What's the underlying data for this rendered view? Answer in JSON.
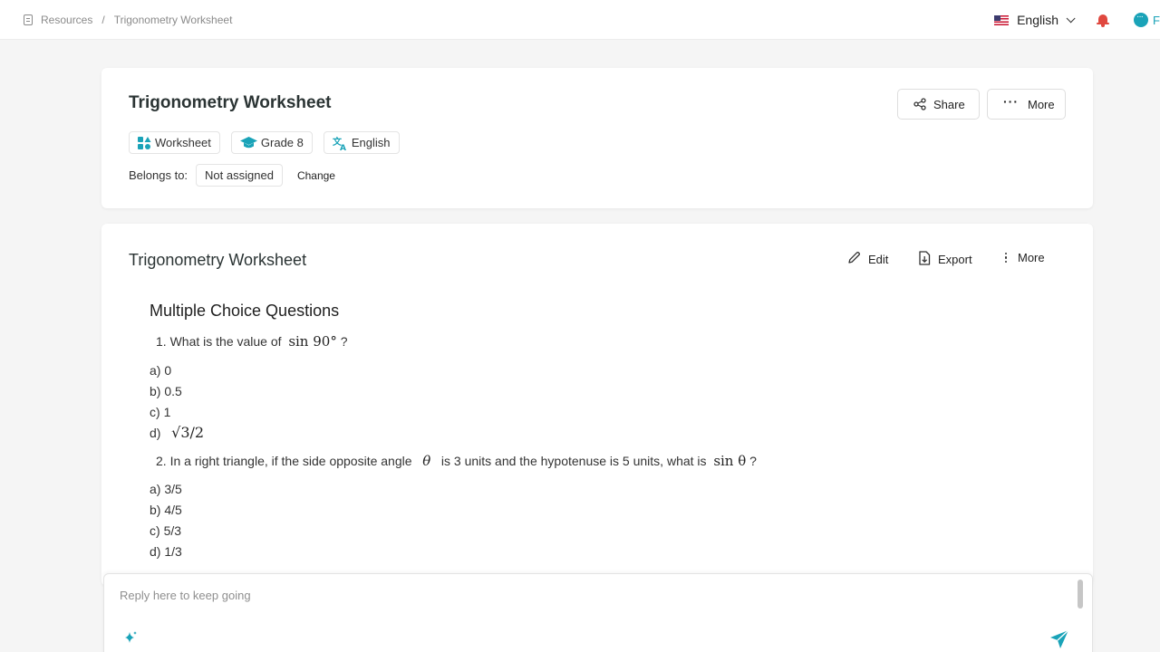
{
  "breadcrumb": {
    "root": "Resources",
    "separator": "/",
    "current": "Trigonometry Worksheet"
  },
  "topbar": {
    "language": "English",
    "cut_letter": "F"
  },
  "header_card": {
    "title": "Trigonometry Worksheet",
    "share_label": "Share",
    "more_label": "More",
    "tags": [
      "Worksheet",
      "Grade 8",
      "English"
    ],
    "belongs_label": "Belongs to:",
    "belongs_value": "Not assigned",
    "change_label": "Change"
  },
  "content_card": {
    "title": "Trigonometry Worksheet",
    "edit_label": "Edit",
    "export_label": "Export",
    "more_label": "More",
    "section_heading": "Multiple Choice Questions",
    "questions": [
      {
        "number": "1.",
        "text_before": "What is the value of",
        "math": "sin 90°",
        "text_after": "?",
        "options": [
          {
            "letter": "a)",
            "text": "0"
          },
          {
            "letter": "b)",
            "text": "0.5"
          },
          {
            "letter": "c)",
            "text": "1"
          },
          {
            "letter": "d)",
            "text": "√3/2"
          }
        ]
      },
      {
        "number": "2.",
        "text_before": "In a right triangle, if the side opposite angle",
        "math_mid": "θ",
        "text_mid": "is 3 units and the hypotenuse is 5 units, what is",
        "math": "sin θ",
        "text_after": "?",
        "options": [
          {
            "letter": "a)",
            "text": "3/5"
          },
          {
            "letter": "b)",
            "text": "4/5"
          },
          {
            "letter": "c)",
            "text": "5/3"
          },
          {
            "letter": "d)",
            "text": "1/3"
          }
        ]
      }
    ]
  },
  "reply": {
    "placeholder": "Reply here to keep going"
  },
  "colors": {
    "accent": "#1aa3b8",
    "send": "#1aa3b8",
    "bell": "#e0483f"
  }
}
